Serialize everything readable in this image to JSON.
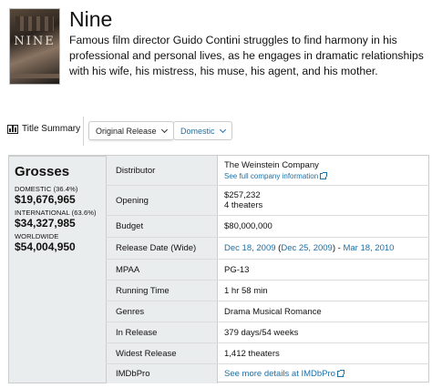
{
  "movie": {
    "title": "Nine",
    "summary": "Famous film director Guido Contini struggles to find harmony in his professional and personal lives, as he engages in dramatic relationships with his wife, his mistress, his muse, his agent, and his mother.",
    "poster_title": "NINE"
  },
  "toolbar": {
    "title_summary": "Title Summary",
    "release_dropdown": "Original Release",
    "region_dropdown": "Domestic"
  },
  "grosses": {
    "heading": "Grosses",
    "domestic_label": "DOMESTIC (36.4%)",
    "domestic_value": "$19,676,965",
    "international_label": "INTERNATIONAL (63.6%)",
    "international_value": "$34,327,985",
    "worldwide_label": "WORLDWIDE",
    "worldwide_value": "$54,004,950"
  },
  "details": {
    "distributor": {
      "label": "Distributor",
      "value": "The Weinstein Company",
      "link": "See full company information"
    },
    "opening": {
      "label": "Opening",
      "value": "$257,232",
      "sub": "4 theaters"
    },
    "budget": {
      "label": "Budget",
      "value": "$80,000,000"
    },
    "release": {
      "label": "Release Date (Wide)",
      "date1": "Dec 18, 2009",
      "open_paren": " (",
      "date2": "Dec 25, 2009",
      "close_paren": ") - ",
      "date3": "Mar 18, 2010"
    },
    "mpaa": {
      "label": "MPAA",
      "value": "PG-13"
    },
    "running_time": {
      "label": "Running Time",
      "value": "1 hr 58 min"
    },
    "genres": {
      "label": "Genres",
      "value": "Drama Musical Romance"
    },
    "in_release": {
      "label": "In Release",
      "value": "379 days/54 weeks"
    },
    "widest_release": {
      "label": "Widest Release",
      "value": "1,412 theaters"
    },
    "imdbpro": {
      "label": "IMDbPro",
      "value": "See more details at IMDbPro"
    }
  },
  "colors": {
    "link": "#1d6fa5",
    "label_bg": "#eaeded"
  }
}
